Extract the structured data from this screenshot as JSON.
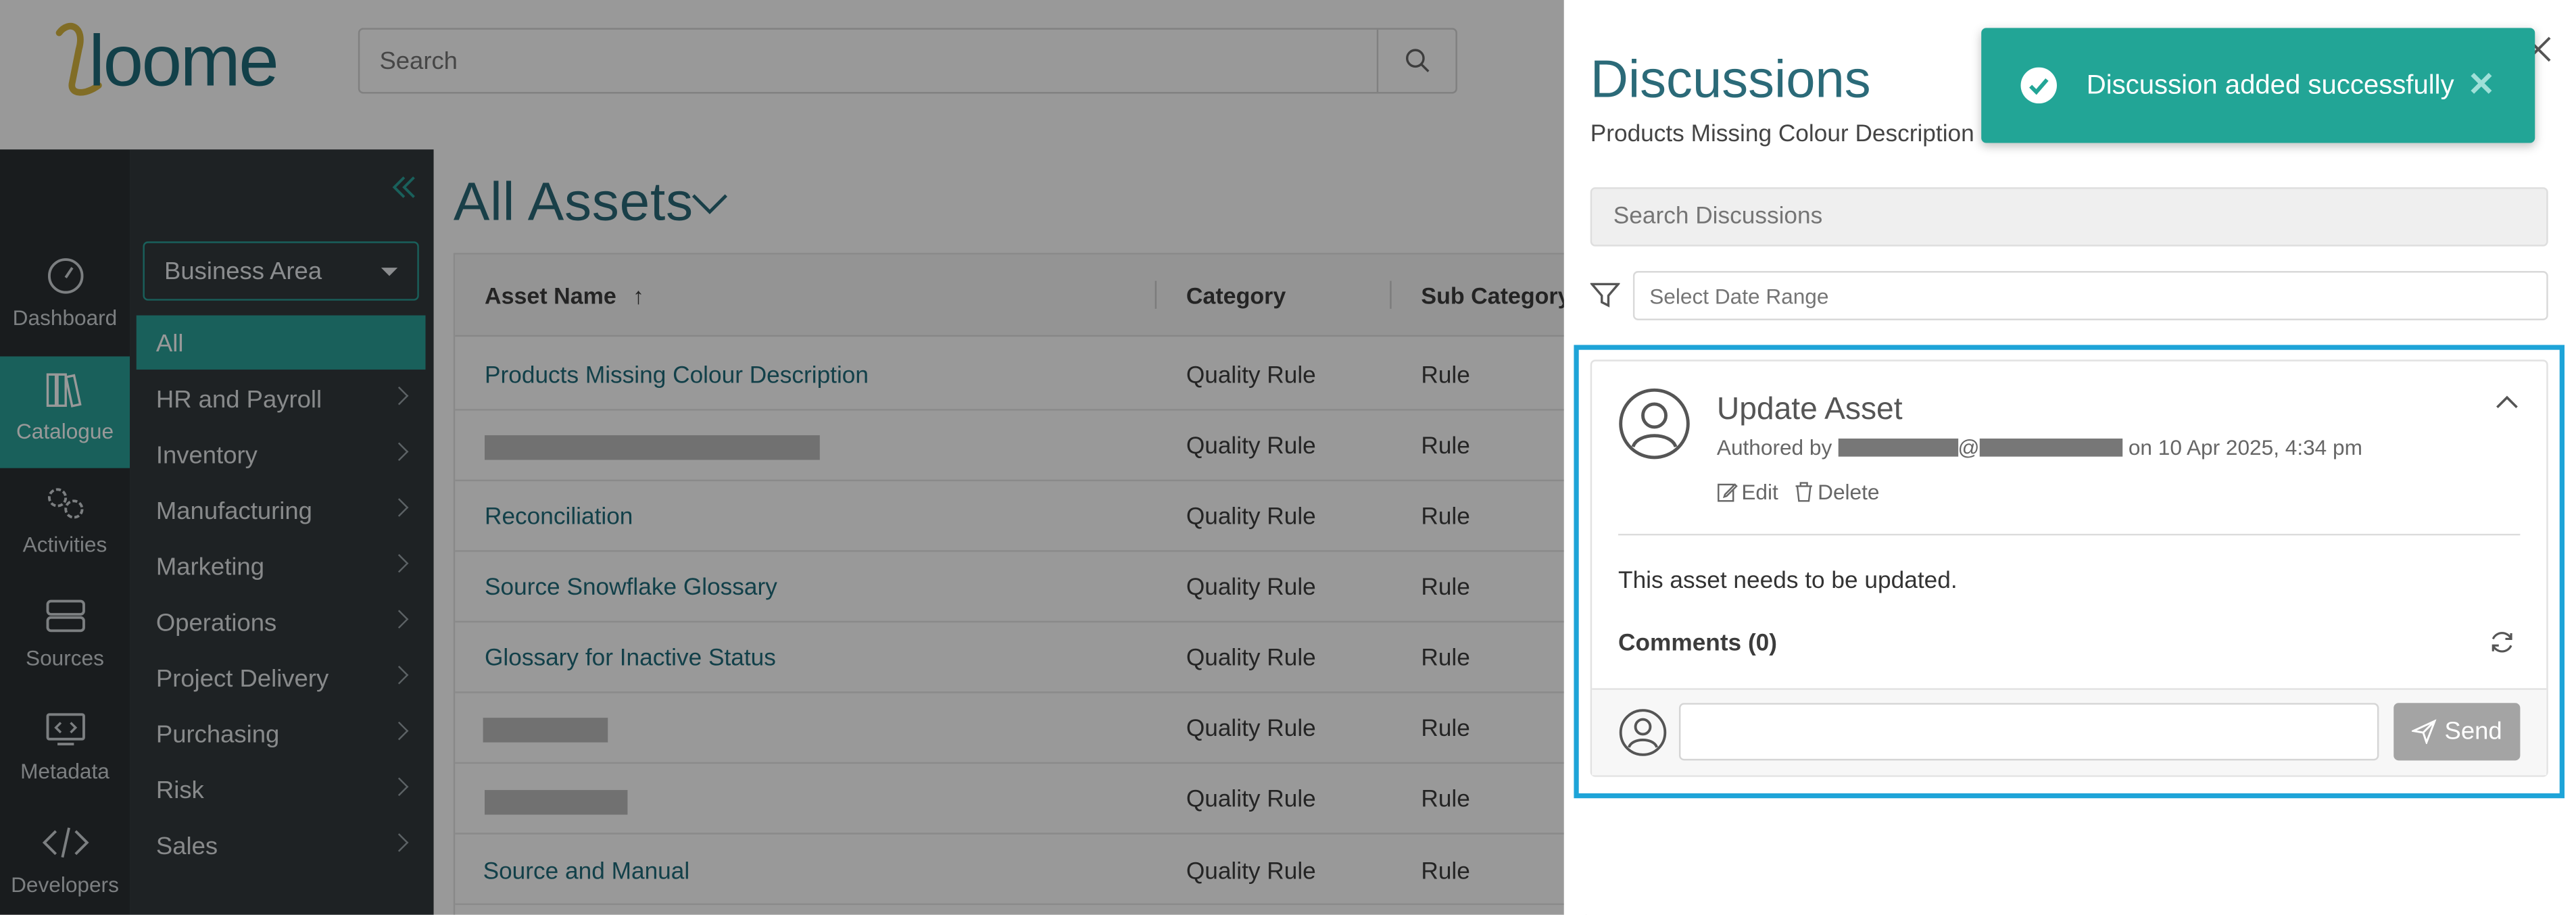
{
  "app": {
    "logo_text": "loome"
  },
  "header": {
    "search_placeholder": "Search"
  },
  "rail": {
    "items": [
      {
        "label": "Dashboard",
        "icon": "gauge-icon"
      },
      {
        "label": "Catalogue",
        "icon": "books-icon",
        "active": true
      },
      {
        "label": "Activities",
        "icon": "gears-icon"
      },
      {
        "label": "Sources",
        "icon": "server-icon"
      },
      {
        "label": "Metadata",
        "icon": "code-monitor-icon"
      },
      {
        "label": "Developers",
        "icon": "code-icon"
      }
    ]
  },
  "subnav": {
    "select_label": "Business Area",
    "items": [
      {
        "label": "All",
        "active": true
      },
      {
        "label": "HR and Payroll"
      },
      {
        "label": "Inventory"
      },
      {
        "label": "Manufacturing"
      },
      {
        "label": "Marketing"
      },
      {
        "label": "Operations"
      },
      {
        "label": "Project Delivery"
      },
      {
        "label": "Purchasing"
      },
      {
        "label": "Risk"
      },
      {
        "label": "Sales"
      }
    ]
  },
  "main": {
    "title": "All Assets",
    "columns": [
      "Asset Name",
      "Category",
      "Sub Category"
    ],
    "sort_indicator": "↑",
    "rows": [
      {
        "name": "Products Missing Colour Description",
        "category": "Quality Rule",
        "sub": "Rule"
      },
      {
        "name": "",
        "category": "Quality Rule",
        "sub": "Rule",
        "redacted": true
      },
      {
        "name": "Reconciliation",
        "category": "Quality Rule",
        "sub": "Rule"
      },
      {
        "name": "Source Snowflake Glossary",
        "category": "Quality Rule",
        "sub": "Rule"
      },
      {
        "name": "Glossary for Inactive Status",
        "category": "Quality Rule",
        "sub": "Rule"
      },
      {
        "name": "",
        "category": "Quality Rule",
        "sub": "Rule",
        "redacted": true
      },
      {
        "name": "",
        "category": "Quality Rule",
        "sub": "Rule",
        "redacted": true
      },
      {
        "name": "Source and Manual",
        "category": "Quality Rule",
        "sub": "Rule"
      }
    ]
  },
  "panel": {
    "title": "Discussions",
    "subtitle": "Products Missing Colour Description",
    "search_placeholder": "Search Discussions",
    "date_placeholder": "Select Date Range",
    "discussion": {
      "title": "Update Asset",
      "authored_prefix": "Authored by",
      "at_sign": "@",
      "date_text": "on 10 Apr 2025, 4:34 pm",
      "edit_label": "Edit",
      "delete_label": "Delete",
      "body": "This asset needs to be updated.",
      "comments_label": "Comments (0)",
      "comment_value": "",
      "send_label": "Send"
    }
  },
  "toast": {
    "message": "Discussion added successfully",
    "close_glyph": "✕"
  },
  "colors": {
    "accent": "#2aa198",
    "highlight": "#1ea4d8",
    "link": "#1f6b7a"
  }
}
